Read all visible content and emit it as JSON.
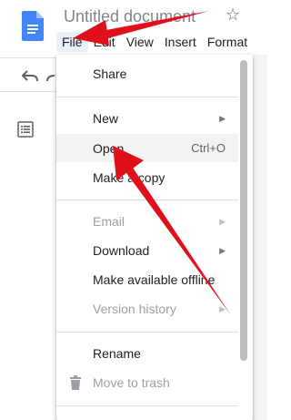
{
  "app": {
    "title": "Untitled document",
    "logo_icon": "docs-logo-icon",
    "star_icon": "star-outline-icon"
  },
  "menubar": {
    "items": [
      "File",
      "Edit",
      "View",
      "Insert",
      "Format"
    ],
    "active": "File"
  },
  "file_menu": {
    "share": "Share",
    "new": "New",
    "open": "Open",
    "open_shortcut": "Ctrl+O",
    "make_copy": "Make a copy",
    "email": "Email",
    "download": "Download",
    "make_available_offline": "Make available offline",
    "version_history": "Version history",
    "rename": "Rename",
    "move_to_trash": "Move to trash",
    "submenu_arrow": "▶"
  },
  "colors": {
    "annotation_arrow": "#e0101b",
    "docs_blue": "#4285f4",
    "menu_hover": "#f1f3f4",
    "disabled_text": "#9aa0a6"
  }
}
